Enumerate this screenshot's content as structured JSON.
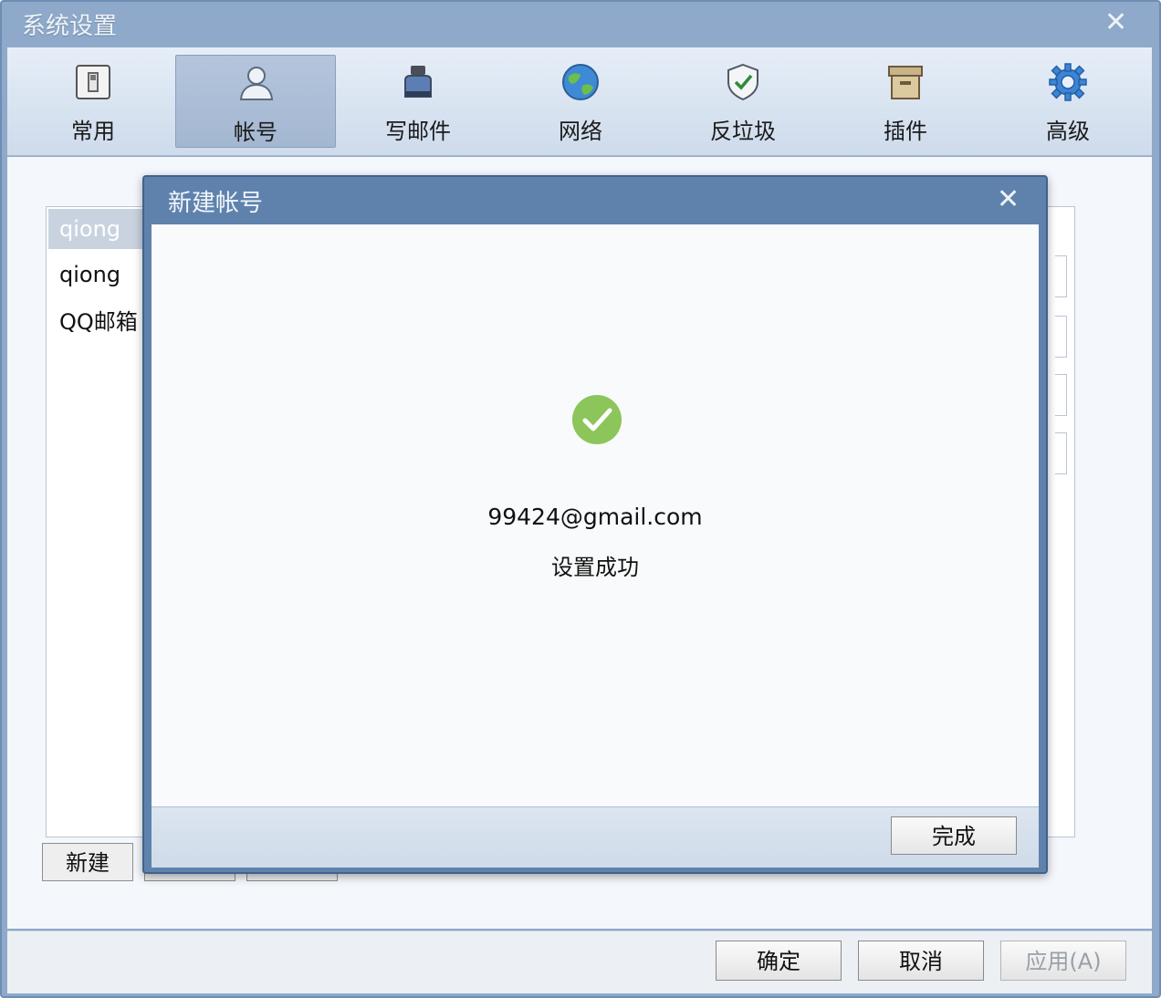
{
  "window": {
    "title": "系统设置"
  },
  "tabs": [
    {
      "label": "常用",
      "icon": "switch-icon"
    },
    {
      "label": "帐号",
      "icon": "user-icon"
    },
    {
      "label": "写邮件",
      "icon": "ink-bottle-icon"
    },
    {
      "label": "网络",
      "icon": "globe-icon"
    },
    {
      "label": "反垃圾",
      "icon": "shield-icon"
    },
    {
      "label": "插件",
      "icon": "box-icon"
    },
    {
      "label": "高级",
      "icon": "gear-icon"
    }
  ],
  "active_tab": "帐号",
  "accounts": {
    "items": [
      {
        "label": "qiong"
      },
      {
        "label": "qiong"
      },
      {
        "label": "QQ邮箱"
      }
    ]
  },
  "account_buttons": {
    "new_label": "新建"
  },
  "footer": {
    "ok_label": "确定",
    "cancel_label": "取消",
    "apply_label": "应用(A)"
  },
  "dialog": {
    "title": "新建帐号",
    "email": "99424@gmail.com",
    "status": "设置成功",
    "done_label": "完成"
  },
  "colors": {
    "titlebar": "#8ea9c9",
    "dialog_header": "#5f82ad",
    "success_green": "#8cc55a"
  }
}
